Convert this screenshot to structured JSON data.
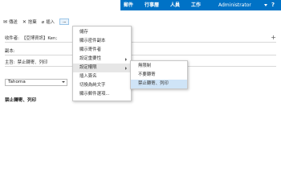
{
  "topnav": {
    "items": [
      "郵件",
      "行事曆",
      "人員",
      "工作"
    ],
    "user": "Administrator",
    "help": "?"
  },
  "toolbar": {
    "send_label": "傳送",
    "discard_label": "捨棄",
    "insert_label": "插入",
    "more_label": "..."
  },
  "compose": {
    "to_label": "收件者:",
    "to_value": "【亞博資訊】Ken;",
    "cc_label": "副本:",
    "subject_label": "主旨:",
    "subject_value": "禁止轉寄、列印",
    "font": "Tahoma",
    "body": "禁止轉寄、列印"
  },
  "menu": {
    "items": [
      "儲存",
      "顯示密件副本",
      "顯示寄件者",
      "設定重要性",
      "設定權限",
      "插入簽名",
      "切換為純文字",
      "顯示郵件選項..."
    ]
  },
  "submenu": {
    "items": [
      "無限制",
      "不要轉寄",
      "禁止轉寄、列印"
    ]
  },
  "colors": {
    "accent": "#0072c6",
    "menu_hover": "#e6e6e6",
    "selected": "#cfe4f7"
  }
}
